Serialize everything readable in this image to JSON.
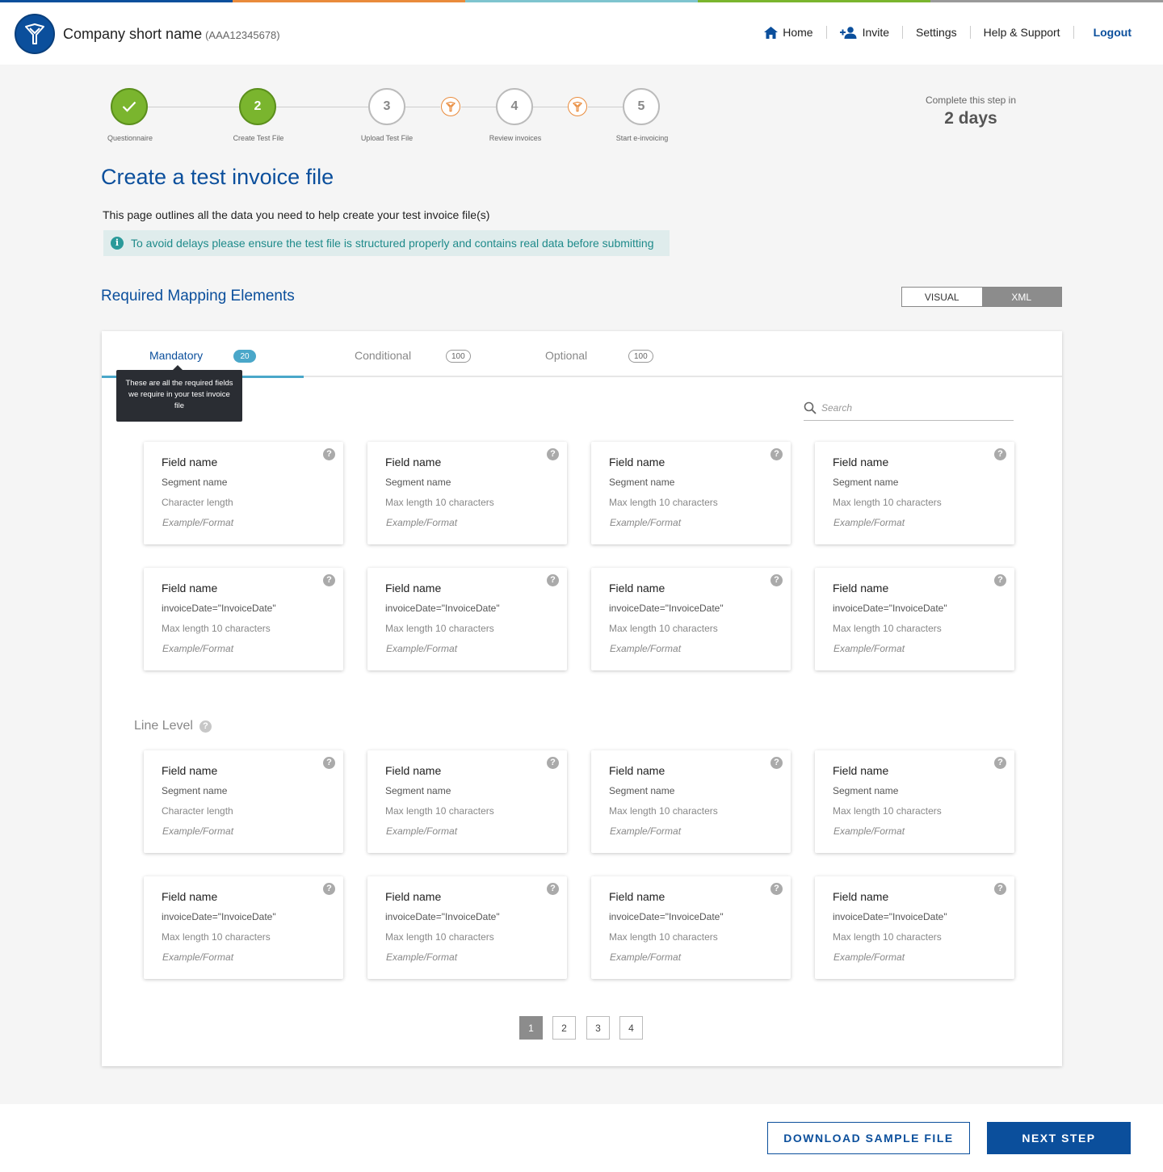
{
  "header": {
    "company_name": "Company short name",
    "company_code": "(AAA12345678)",
    "nav": {
      "home": "Home",
      "invite": "Invite",
      "settings": "Settings",
      "help": "Help & Support",
      "logout": "Logout"
    }
  },
  "stepper": {
    "steps": [
      {
        "number": "1",
        "label": "Questionnaire",
        "state": "done"
      },
      {
        "number": "2",
        "label": "Create Test File",
        "state": "current"
      },
      {
        "number": "3",
        "label": "Upload Test File",
        "state": "todo"
      },
      {
        "number": "4",
        "label": "Review invoices",
        "state": "todo"
      },
      {
        "number": "5",
        "label": "Start e-invoicing",
        "state": "todo"
      }
    ],
    "complete_label": "Complete this step in",
    "complete_value": "2 days"
  },
  "page": {
    "title": "Create a test invoice file",
    "intro": "This page outlines all the data you need to help create your test invoice file(s)",
    "notice": "To avoid delays please ensure the test file is structured properly and contains real data before submitting"
  },
  "mapping": {
    "title": "Required Mapping Elements",
    "toggle": {
      "visual": "VISUAL",
      "xml": "XML",
      "selected": "XML"
    }
  },
  "tabs": [
    {
      "label": "Mandatory",
      "count": "20",
      "active": true
    },
    {
      "label": "Conditional",
      "count": "100",
      "active": false
    },
    {
      "label": "Optional",
      "count": "100",
      "active": false
    }
  ],
  "tooltip": "These are all the required fields we require in your test invoice file",
  "search": {
    "placeholder": "Search"
  },
  "header_level_cards": [
    {
      "field": "Field name",
      "segment": "Segment name",
      "length": "Character length",
      "example": "Example/Format"
    },
    {
      "field": "Field name",
      "segment": "Segment name",
      "length": "Max length 10 characters",
      "example": "Example/Format"
    },
    {
      "field": "Field name",
      "segment": "Segment name",
      "length": "Max length 10 characters",
      "example": "Example/Format"
    },
    {
      "field": "Field name",
      "segment": "Segment name",
      "length": "Max length 10 characters",
      "example": "Example/Format"
    },
    {
      "field": "Field name",
      "segment": "invoiceDate=\"InvoiceDate\"",
      "length": "Max length 10 characters",
      "example": "Example/Format"
    },
    {
      "field": "Field name",
      "segment": "invoiceDate=\"InvoiceDate\"",
      "length": "Max length 10 characters",
      "example": "Example/Format"
    },
    {
      "field": "Field name",
      "segment": "invoiceDate=\"InvoiceDate\"",
      "length": "Max length 10 characters",
      "example": "Example/Format"
    },
    {
      "field": "Field name",
      "segment": "invoiceDate=\"InvoiceDate\"",
      "length": "Max length 10 characters",
      "example": "Example/Format"
    }
  ],
  "line_level": {
    "title": "Line Level",
    "cards": [
      {
        "field": "Field name",
        "segment": "Segment name",
        "length": "Character length",
        "example": "Example/Format"
      },
      {
        "field": "Field name",
        "segment": "Segment name",
        "length": "Max length 10 characters",
        "example": "Example/Format"
      },
      {
        "field": "Field name",
        "segment": "Segment name",
        "length": "Max length 10 characters",
        "example": "Example/Format"
      },
      {
        "field": "Field name",
        "segment": "Segment name",
        "length": "Max length 10 characters",
        "example": "Example/Format"
      },
      {
        "field": "Field name",
        "segment": "invoiceDate=\"InvoiceDate\"",
        "length": "Max length 10 characters",
        "example": "Example/Format"
      },
      {
        "field": "Field name",
        "segment": "invoiceDate=\"InvoiceDate\"",
        "length": "Max length 10 characters",
        "example": "Example/Format"
      },
      {
        "field": "Field name",
        "segment": "invoiceDate=\"InvoiceDate\"",
        "length": "Max length 10 characters",
        "example": "Example/Format"
      },
      {
        "field": "Field name",
        "segment": "invoiceDate=\"InvoiceDate\"",
        "length": "Max length 10 characters",
        "example": "Example/Format"
      }
    ]
  },
  "help_glyph": "?",
  "info_glyph": "i",
  "pagination": {
    "pages": [
      "1",
      "2",
      "3",
      "4"
    ],
    "current": "1"
  },
  "footer": {
    "download_label": "DOWNLOAD SAMPLE FILE",
    "next_label": "NEXT STEP"
  },
  "colors": {
    "brand_blue": "#0b4f9c",
    "step_green": "#7ab52e",
    "accent_teal": "#4aa7c9",
    "accent_orange": "#e98b3c",
    "stripe": [
      "#0b4f9c",
      "#e98b3c",
      "#7fc4cf",
      "#7ab52e",
      "#9a9a9a"
    ]
  }
}
